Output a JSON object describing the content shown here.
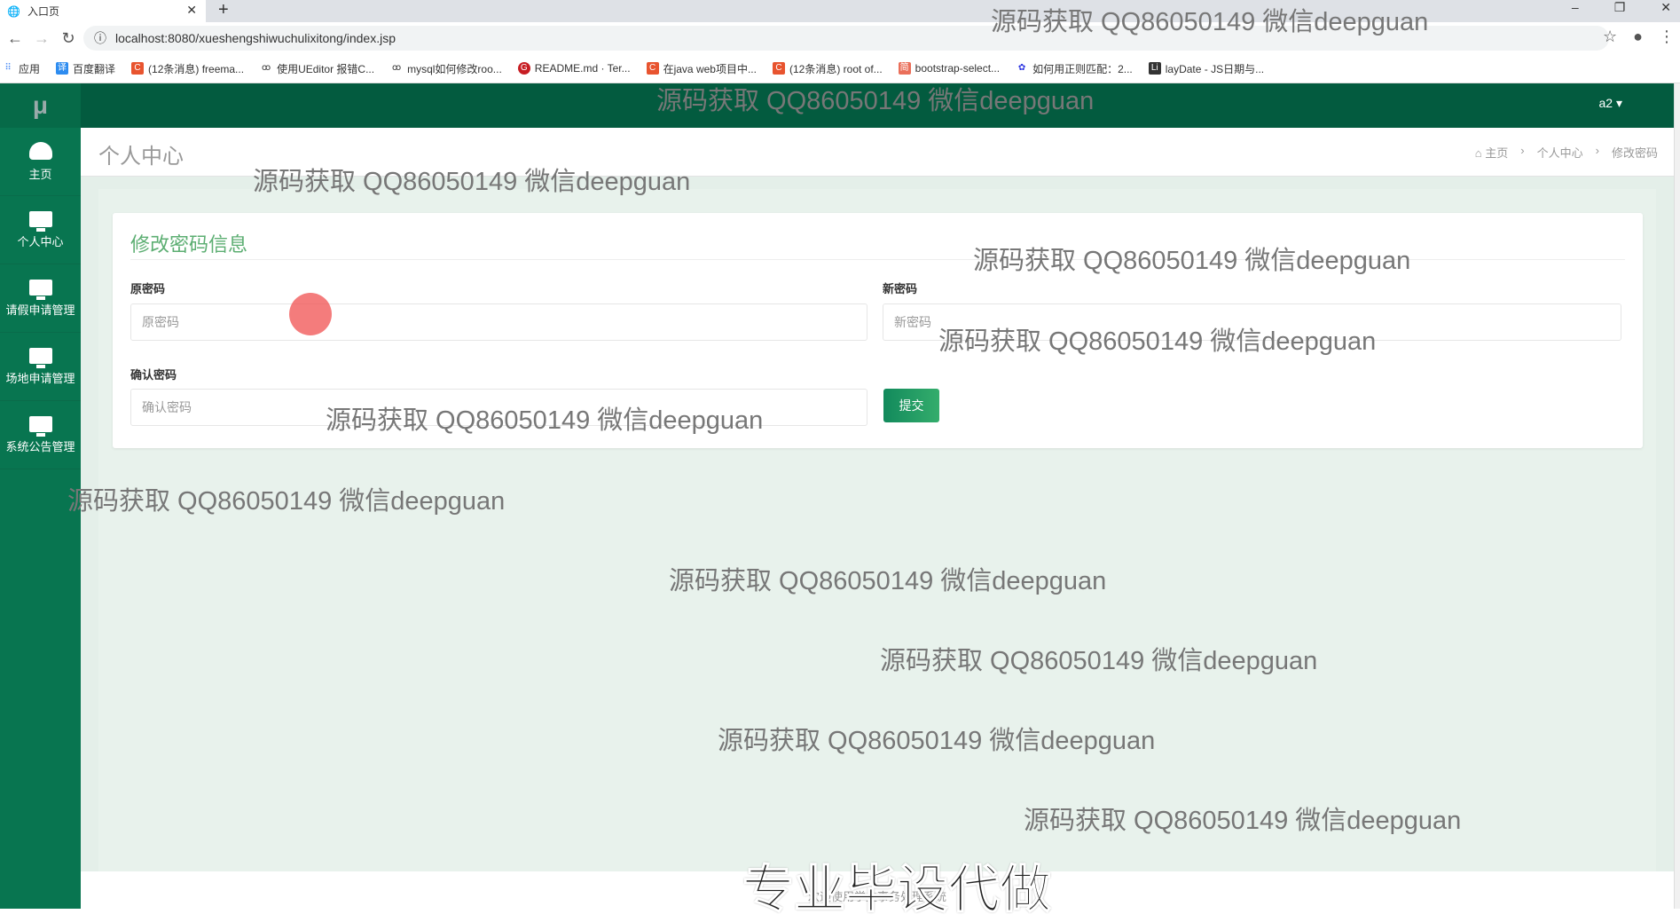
{
  "browser": {
    "tab_title": "入口页",
    "url": "localhost:8080/xueshengshiwuchulixitong/index.jsp",
    "bookmarks": [
      "应用",
      "百度翻译",
      "(12条消息) freema...",
      "使用UEditor 报错C...",
      "mysql如何修改roo...",
      "README.md · Ter...",
      "在java web项目中...",
      "(12条消息) root of...",
      "bootstrap-select...",
      "如何用正则匹配：2...",
      "layDate - JS日期与..."
    ]
  },
  "app": {
    "logo": "μ",
    "user": "a2 ▾",
    "sidebar": [
      {
        "label": "主页",
        "icon": "dashboard-icon"
      },
      {
        "label": "个人中心",
        "icon": "monitor-icon"
      },
      {
        "label": "请假申请管理",
        "icon": "monitor-icon"
      },
      {
        "label": "场地申请管理",
        "icon": "monitor-icon"
      },
      {
        "label": "系统公告管理",
        "icon": "monitor-icon"
      }
    ],
    "page_title": "个人中心",
    "breadcrumb": [
      "主页",
      "个人中心",
      "修改密码"
    ],
    "form": {
      "title": "修改密码信息",
      "old_label": "原密码",
      "old_placeholder": "原密码",
      "new_label": "新密码",
      "new_placeholder": "新密码",
      "confirm_label": "确认密码",
      "confirm_placeholder": "确认密码",
      "submit": "提交"
    },
    "footer": "欢迎使用学生事务处理系统"
  },
  "watermark": "源码获取 QQ86050149 微信deepguan",
  "promo": "专业毕设代做"
}
